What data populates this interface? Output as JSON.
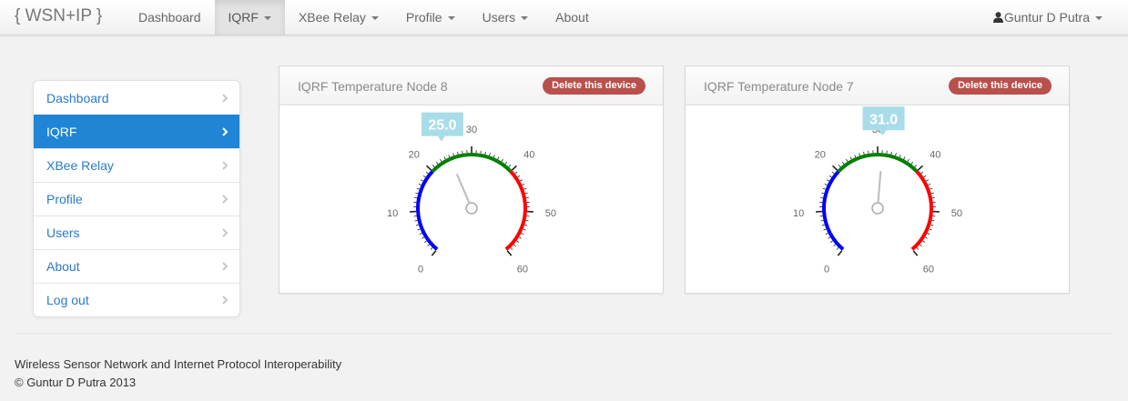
{
  "navbar": {
    "brand": "{ WSN+IP }",
    "items": [
      {
        "label": "Dashboard",
        "dropdown": false,
        "active": false
      },
      {
        "label": "IQRF",
        "dropdown": true,
        "active": true
      },
      {
        "label": "XBee Relay",
        "dropdown": true,
        "active": false
      },
      {
        "label": "Profile",
        "dropdown": true,
        "active": false
      },
      {
        "label": "Users",
        "dropdown": true,
        "active": false
      },
      {
        "label": "About",
        "dropdown": false,
        "active": false
      }
    ],
    "user": "Guntur D Putra",
    "user_icon": "user-icon"
  },
  "sidebar": {
    "items": [
      {
        "label": "Dashboard",
        "active": false
      },
      {
        "label": "IQRF",
        "active": true
      },
      {
        "label": "XBee Relay",
        "active": false
      },
      {
        "label": "Profile",
        "active": false
      },
      {
        "label": "Users",
        "active": false
      },
      {
        "label": "About",
        "active": false
      },
      {
        "label": "Log out",
        "active": false
      }
    ]
  },
  "devices": [
    {
      "title": "IQRF Temperature Node 8",
      "delete_label": "Delete this device",
      "value": 25.0,
      "value_label": "25.0"
    },
    {
      "title": "IQRF Temperature Node 7",
      "delete_label": "Delete this device",
      "value": 31.0,
      "value_label": "31.0"
    }
  ],
  "gauge": {
    "min": 0,
    "max": 60,
    "tick_labels": [
      "0",
      "10",
      "20",
      "30",
      "40",
      "50",
      "60"
    ],
    "bands": [
      {
        "from": 0,
        "to": 20,
        "color": "#0000ff"
      },
      {
        "from": 20,
        "to": 40,
        "color": "#008000"
      },
      {
        "from": 40,
        "to": 60,
        "color": "#ff0000"
      }
    ],
    "value_box_color": "#a8dce8"
  },
  "footer": {
    "line1": "Wireless Sensor Network and Internet Protocol Interoperability",
    "line2": "© Guntur D Putra 2013"
  }
}
